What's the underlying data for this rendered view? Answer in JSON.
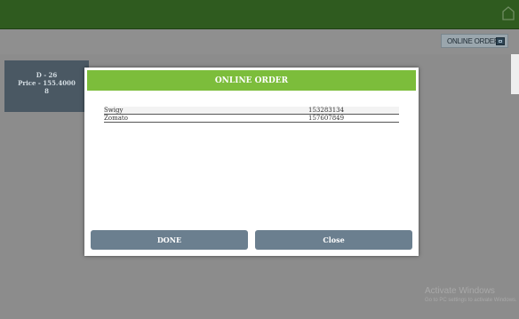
{
  "header": {
    "online_order_button": "ONLINE ORDER"
  },
  "table_card": {
    "line1": "D - 26",
    "line2": "Price - 155.4000",
    "line3": "8"
  },
  "modal": {
    "title": "ONLINE ORDER",
    "orders": [
      {
        "name": "Swigy",
        "number": "153283134"
      },
      {
        "name": "Zomato",
        "number": "157607849"
      }
    ],
    "done_label": "DONE",
    "close_label": "Close"
  },
  "watermark": {
    "line1": "Activate Windows",
    "line2": "Go to PC settings to activate Windows."
  },
  "colors": {
    "topbar": "#2f5b1f",
    "modal_header": "#7cbd3b",
    "button": "#6b7f8f"
  },
  "icons": {
    "topbar": "home-icon",
    "online_order": "window-icon"
  }
}
